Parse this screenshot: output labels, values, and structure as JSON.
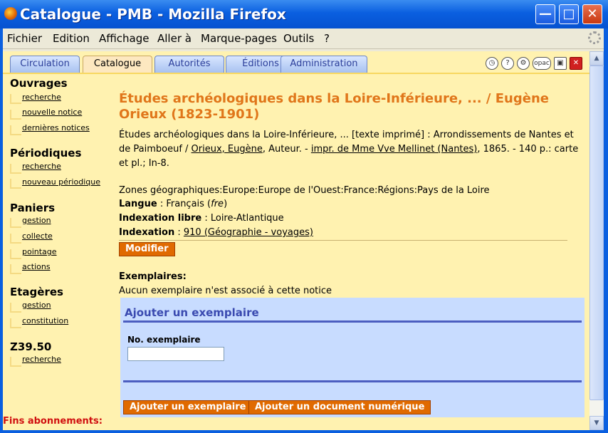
{
  "window": {
    "title": "Catalogue - PMB - Mozilla Firefox"
  },
  "menu": [
    "Fichier",
    "Edition",
    "Affichage",
    "Aller à",
    "Marque-pages",
    "Outils",
    "?"
  ],
  "tabs": [
    {
      "label": "Circulation",
      "active": false
    },
    {
      "label": "Catalogue",
      "active": true
    },
    {
      "label": "Autorités",
      "active": false
    },
    {
      "label": "Éditions",
      "active": false
    },
    {
      "label": "Administration",
      "active": false
    }
  ],
  "toolbar_icons": {
    "opac": "opac"
  },
  "sidebar": {
    "ouvrages": {
      "title": "Ouvrages",
      "items": [
        "recherche",
        "nouvelle notice",
        "dernières notices"
      ]
    },
    "periodiques": {
      "title": "Périodiques",
      "items": [
        "recherche",
        "nouveau périodique"
      ]
    },
    "paniers": {
      "title": "Paniers",
      "items": [
        "gestion",
        "collecte",
        "pointage",
        "actions"
      ]
    },
    "etageres": {
      "title": "Etagères",
      "items": [
        "gestion",
        "constitution"
      ]
    },
    "z3950": {
      "title": "Z39.50",
      "items": [
        "recherche"
      ]
    },
    "fins": "Fins abonnements:"
  },
  "notice": {
    "title": "Études archéologiques dans la Loire-Inférieure, ... / Eugène Orieux (1823-1901)",
    "desc_a": "Études archéologiques dans la Loire-Inférieure, ... [texte imprimé] : Arrondissements de Nantes et de Paimboeuf / ",
    "author_link": "Orieux, Eugène",
    "desc_b": ", Auteur. - ",
    "publisher_link": "impr. de Mme Vve Mellinet (Nantes)",
    "desc_c": ", 1865. - 140 p.: carte et pl.; In-8.",
    "zones": "Zones géographiques:Europe:Europe de l'Ouest:France:Régions:Pays de la Loire",
    "langue_label": "Langue",
    "langue_value": " : Français (",
    "langue_code": "fre",
    "langue_end": ")",
    "idx_libre_label": "Indexation libre",
    "idx_libre_value": " : Loire-Atlantique",
    "idx_label": "Indexation",
    "idx_sep": " : ",
    "idx_link": "910 (Géographie - voyages)",
    "modifier": "Modifier"
  },
  "exemplaires": {
    "heading": "Exemplaires:",
    "none_text": "Aucun exemplaire n'est associé à cette notice",
    "panel_title": "Ajouter un exemplaire",
    "field_label": "No. exemplaire",
    "field_value": "",
    "btn_add": "Ajouter un exemplaire",
    "btn_add_doc": "Ajouter un document numérique"
  }
}
